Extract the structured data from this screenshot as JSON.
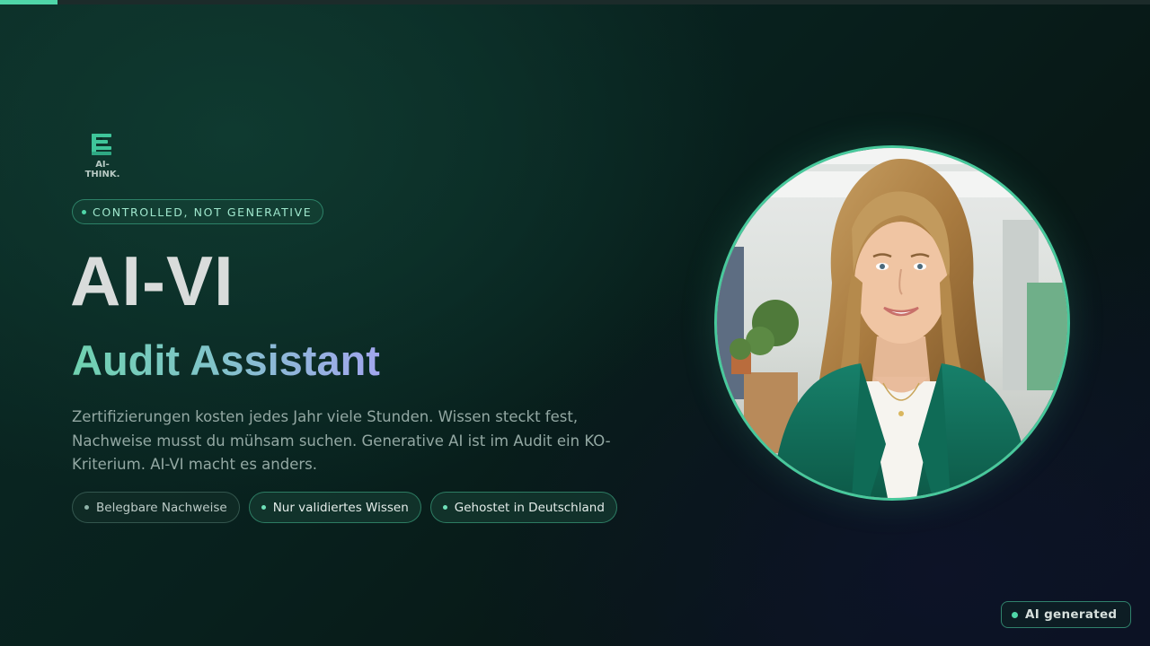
{
  "progress": {
    "value": 0.05,
    "color": "#4fd6a8"
  },
  "brand": {
    "logo_text": "AI-THINK.",
    "logo_icon": "ai-think-logo-icon"
  },
  "hero": {
    "tag": "CONTROLLED, NOT GENERATIVE",
    "title": "AI-VI",
    "subtitle": "Audit Assistant",
    "description": "Zertifizierungen kosten jedes Jahr viele Stunden. Wissen steckt fest, Nachweise musst du mühsam suchen. Generative AI ist im Audit ein KO-Kriterium. AI-VI macht es anders."
  },
  "features": [
    {
      "label": "Belegbare Nachweise",
      "active": false
    },
    {
      "label": "Nur validiertes Wissen",
      "active": true
    },
    {
      "label": "Gehostet in Deutschland",
      "active": true
    }
  ],
  "avatar": {
    "icon": "presenter-portrait"
  },
  "badge": {
    "label": "AI generated"
  },
  "colors": {
    "accent": "#4fd6a8",
    "background": "#0b2a25",
    "title": "#d9dcdb"
  }
}
